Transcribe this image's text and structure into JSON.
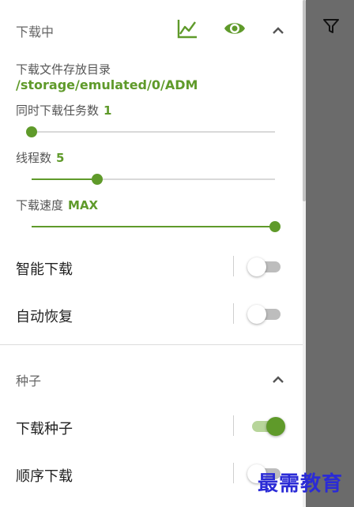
{
  "downloading": {
    "title": "下载中",
    "icons": [
      "chart-line-icon",
      "eye-icon",
      "chevron-up-icon"
    ],
    "directory_label": "下载文件存放目录",
    "directory_path": "/storage/emulated/0/ADM",
    "concurrent_label": "同时下载任务数",
    "concurrent_value": "1",
    "concurrent_level": 0.0,
    "threads_label": "线程数",
    "threads_value": "5",
    "threads_level": 0.27,
    "speed_label": "下载速度",
    "speed_value": "MAX",
    "speed_level": 1.0,
    "smart_download_label": "智能下载",
    "smart_download_on": false,
    "auto_resume_label": "自动恢复",
    "auto_resume_on": false
  },
  "torrent": {
    "title": "种子",
    "download_torrent_label": "下载种子",
    "download_torrent_on": true,
    "sequential_label": "顺序下载",
    "sequential_on": false
  },
  "side": {
    "icon": "filter-icon"
  },
  "watermark": "最需教育",
  "colors": {
    "accent": "#5f9a2a",
    "scrim": "#6b6b6b"
  }
}
